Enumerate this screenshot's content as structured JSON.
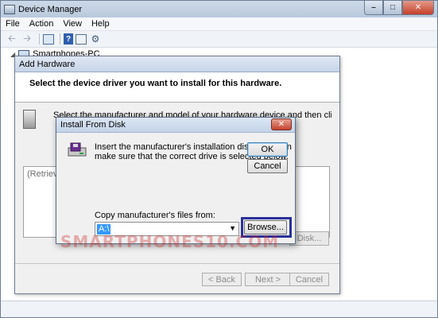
{
  "device_manager": {
    "title": "Device Manager",
    "menu": [
      "File",
      "Action",
      "View",
      "Help"
    ],
    "tree_root": "Smartphones-PC"
  },
  "add_hardware": {
    "title": "Add Hardware",
    "header": "Select the device driver you want to install for this hardware.",
    "description": "Select the manufacturer and model of your hardware device and then click Next. If you have a",
    "list_placeholder": "(Retrievin",
    "have_disk_label": "Disk...",
    "back_label": "< Back",
    "next_label": "Next >",
    "cancel_label": "Cancel"
  },
  "install_from_disk": {
    "title": "Install From Disk",
    "instruction_line1": "Insert the manufacturer's installation disk, and then",
    "instruction_line2": "make sure that the correct drive is selected below.",
    "ok_label": "OK",
    "cancel_label": "Cancel",
    "copy_from_label": "Copy manufacturer's files from:",
    "copy_from_value": "A:\\",
    "browse_label": "Browse..."
  },
  "watermark": "SMARTPHONES10.COM",
  "colors": {
    "highlight_box": "#29309a",
    "selection": "#3399ff"
  }
}
